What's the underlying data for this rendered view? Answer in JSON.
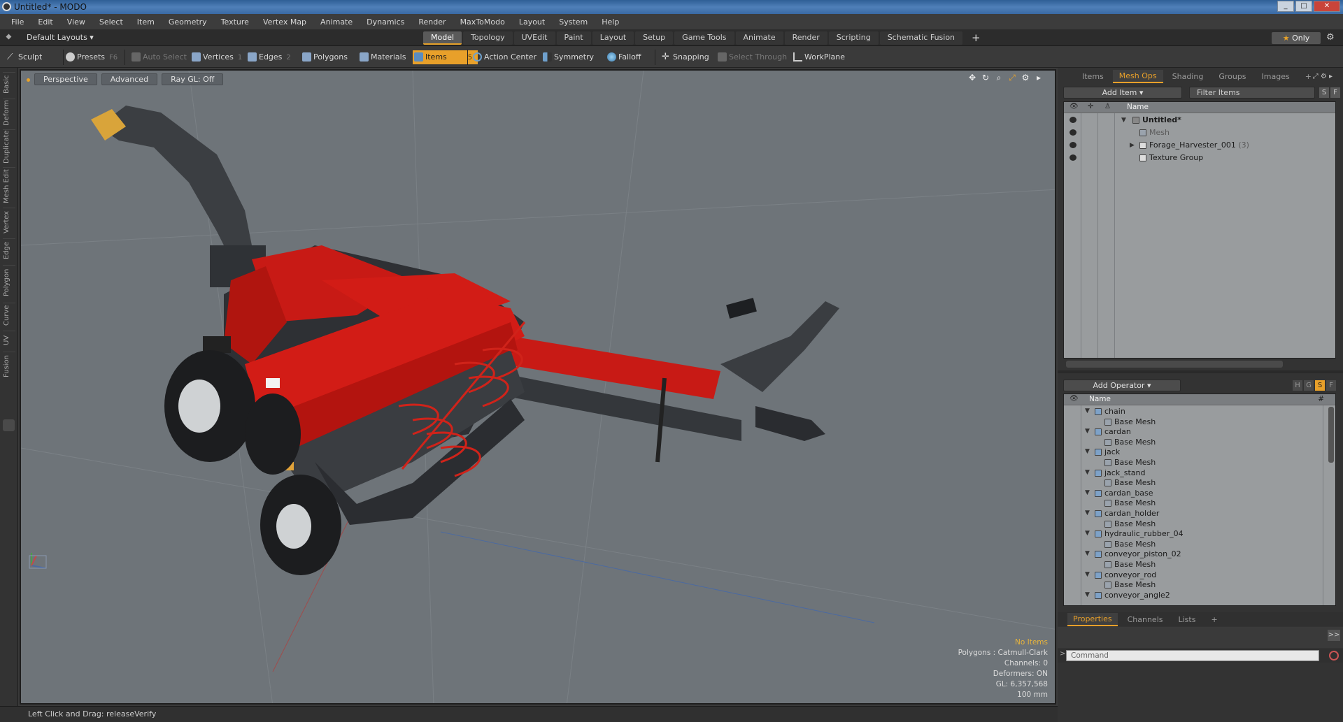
{
  "window": {
    "title": "Untitled* - MODO",
    "controls": [
      "_",
      "□",
      "✕"
    ]
  },
  "menu": [
    "File",
    "Edit",
    "View",
    "Select",
    "Item",
    "Geometry",
    "Texture",
    "Vertex Map",
    "Animate",
    "Dynamics",
    "Render",
    "MaxToModo",
    "Layout",
    "System",
    "Help"
  ],
  "layouts": {
    "selector": "Default Layouts ▾",
    "tabs": [
      "Model",
      "Topology",
      "UVEdit",
      "Paint",
      "Layout",
      "Setup",
      "Game Tools",
      "Animate",
      "Render",
      "Scripting",
      "Schematic Fusion"
    ],
    "active_tab": "Model",
    "plus": "+",
    "only_star": "★",
    "only_label": "Only"
  },
  "toolbar": {
    "sculpt": "Sculpt",
    "presets": "Presets",
    "presets_key": "F6",
    "auto_select": "Auto Select",
    "vertices": "Vertices",
    "vertices_key": "1",
    "edges": "Edges",
    "edges_key": "2",
    "polygons": "Polygons",
    "materials": "Materials",
    "items": "Items",
    "items_key": "5",
    "action_center": "Action Center",
    "symmetry": "Symmetry",
    "falloff": "Falloff",
    "snapping": "Snapping",
    "select_through": "Select Through",
    "workplane": "WorkPlane"
  },
  "left_tabs": [
    "Basic",
    "Deform",
    "Duplicate",
    "Mesh Edit",
    "Vertex",
    "Edge",
    "Polygon",
    "Curve",
    "UV",
    "Fusion"
  ],
  "viewport": {
    "view": "Perspective",
    "shading": "Advanced",
    "raygl": "Ray GL: Off",
    "info": {
      "selection": "No Items",
      "polygons": "Polygons : Catmull-Clark",
      "channels": "Channels: 0",
      "deformers": "Deformers: ON",
      "gl": "GL: 6,357,568",
      "grid": "100 mm"
    }
  },
  "status": {
    "hint": "Left Click and Drag:  releaseVerify"
  },
  "right_panel": {
    "tabs": [
      "Items",
      "Mesh Ops",
      "Shading",
      "Groups",
      "Images",
      "+"
    ],
    "active_tab": "Mesh Ops",
    "add_item": "Add Item",
    "filter": "Filter Items",
    "s_btn": "S",
    "f_btn": "F",
    "list_header": "Name",
    "items": [
      {
        "label": "Untitled*",
        "count": ""
      },
      {
        "label": "Mesh",
        "count": ""
      },
      {
        "label": "Forage_Harvester_001",
        "count": "(3)"
      },
      {
        "label": "Texture Group",
        "count": ""
      }
    ],
    "add_operator": "Add Operator",
    "op_buttons": [
      "H",
      "G",
      "S",
      "F"
    ],
    "op_header": "Name",
    "op_hash": "#",
    "operators": [
      {
        "name": "chain",
        "child": "Base Mesh"
      },
      {
        "name": "cardan",
        "child": "Base Mesh"
      },
      {
        "name": "jack",
        "child": "Base Mesh"
      },
      {
        "name": "jack_stand",
        "child": "Base Mesh"
      },
      {
        "name": "cardan_base",
        "child": "Base Mesh"
      },
      {
        "name": "cardan_holder",
        "child": "Base Mesh"
      },
      {
        "name": "hydraulic_rubber_04",
        "child": "Base Mesh"
      },
      {
        "name": "conveyor_piston_02",
        "child": "Base Mesh"
      },
      {
        "name": "conveyor_rod",
        "child": "Base Mesh"
      },
      {
        "name": "conveyor_angle2",
        "child": ""
      }
    ],
    "props_tabs": [
      "Properties",
      "Channels",
      "Lists",
      "+"
    ],
    "props_active": "Properties",
    "expand": ">>",
    "command_placeholder": "Command",
    "command_prompt": ">"
  }
}
